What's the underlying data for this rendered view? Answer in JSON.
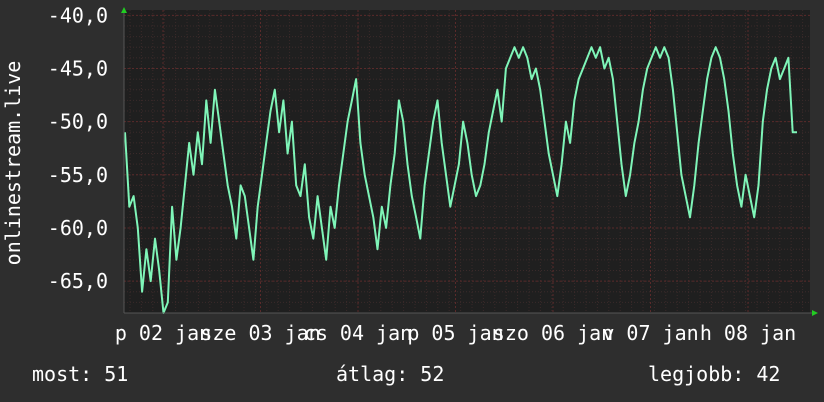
{
  "colors": {
    "background": "#2e2e2e",
    "plot_background": "#1f1f1f",
    "grid_major": "#5a2a2a",
    "grid_minor": "#3a2a2a",
    "line": "#7ff5b8",
    "axis_arrow": "#22cc22",
    "text": "#ffffff"
  },
  "chart_data": {
    "type": "line",
    "ylabel": "onlinestream.live",
    "ylim": [
      -68,
      -39.5
    ],
    "y_ticks": [
      {
        "value": -40,
        "label": "-40,0"
      },
      {
        "value": -45,
        "label": "-45,0"
      },
      {
        "value": -50,
        "label": "-50,0"
      },
      {
        "value": -55,
        "label": "-55,0"
      },
      {
        "value": -60,
        "label": "-60,0"
      },
      {
        "value": -65,
        "label": "-65,0"
      }
    ],
    "x_ticks": [
      "p 02 jan",
      "sze 03 jan",
      "cs 04 jan",
      "p 05 jan",
      "szo 06 jan",
      "v 07 jan",
      "h 08 jan"
    ],
    "grid": true,
    "series": [
      {
        "values": [
          -51,
          -58,
          -57,
          -60,
          -66,
          -62,
          -65,
          -61,
          -64,
          -68,
          -67,
          -58,
          -63,
          -60,
          -56,
          -52,
          -55,
          -51,
          -54,
          -48,
          -52,
          -47,
          -50,
          -53,
          -56,
          -58,
          -61,
          -56,
          -57,
          -60,
          -63,
          -58,
          -55,
          -52,
          -49,
          -47,
          -51,
          -48,
          -53,
          -50,
          -56,
          -57,
          -54,
          -59,
          -61,
          -57,
          -60,
          -63,
          -58,
          -60,
          -56,
          -53,
          -50,
          -48,
          -46,
          -52,
          -55,
          -57,
          -59,
          -62,
          -58,
          -60,
          -56,
          -53,
          -48,
          -50,
          -54,
          -57,
          -59,
          -61,
          -56,
          -53,
          -50,
          -48,
          -52,
          -55,
          -58,
          -56,
          -54,
          -50,
          -52,
          -55,
          -57,
          -56,
          -54,
          -51,
          -49,
          -47,
          -50,
          -45,
          -44,
          -43,
          -44,
          -43,
          -44,
          -46,
          -45,
          -47,
          -50,
          -53,
          -55,
          -57,
          -54,
          -50,
          -52,
          -48,
          -46,
          -45,
          -44,
          -43,
          -44,
          -43,
          -45,
          -44,
          -46,
          -50,
          -54,
          -57,
          -55,
          -52,
          -50,
          -47,
          -45,
          -44,
          -43,
          -44,
          -43,
          -44,
          -47,
          -51,
          -55,
          -57,
          -59,
          -56,
          -52,
          -49,
          -46,
          -44,
          -43,
          -44,
          -46,
          -49,
          -53,
          -56,
          -58,
          -55,
          -57,
          -59,
          -56,
          -50,
          -47,
          -45,
          -44,
          -46,
          -45,
          -44,
          -51,
          -51
        ]
      }
    ]
  },
  "summary": {
    "current": "most: 51",
    "average": "átlag: 52",
    "best": "legjobb: 42"
  }
}
